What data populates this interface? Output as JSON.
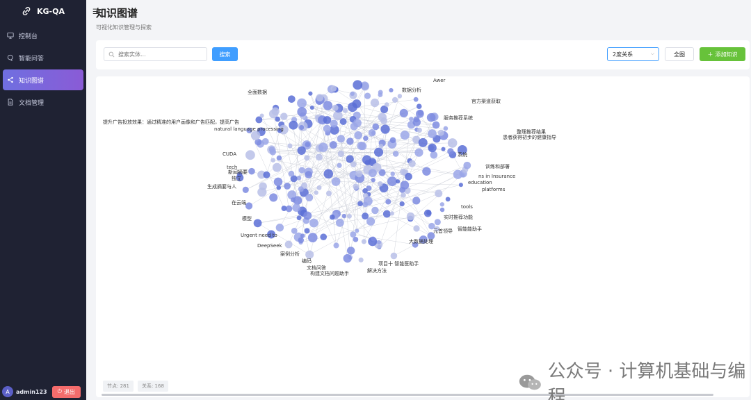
{
  "app": {
    "name": "KG-QA"
  },
  "sidebar": {
    "items": [
      {
        "label": "控制台",
        "icon": "monitor-icon"
      },
      {
        "label": "智能问答",
        "icon": "chat-icon"
      },
      {
        "label": "知识图谱",
        "icon": "share-icon"
      },
      {
        "label": "文档管理",
        "icon": "document-icon"
      }
    ]
  },
  "user": {
    "avatar": "A",
    "name": "admin123",
    "logout": "退出"
  },
  "page": {
    "title": "知识图谱",
    "subtitle": "可视化知识管理与探索"
  },
  "toolbar": {
    "search_placeholder": "搜索实体...",
    "search_button": "搜索",
    "relation_select": "2度关系",
    "full_button": "全图",
    "add_button": "添加知识"
  },
  "graph": {
    "labels": [
      "提升广告投放效果：通过精准的用户画像和广告匹配，提高广告",
      "官方渠道获取",
      "数据分析",
      "整理推荐结果",
      "患者获得初步的健康指导",
      "CUDA",
      "tech",
      "新闻摘要",
      "独立",
      "生成摘要与人",
      "在云端",
      "模型",
      "Urgent need to",
      "DeepSeek",
      "案例分析",
      "编码",
      "文档问答",
      "构建文档问题助手",
      "解决方法",
      "项目十 智能医助手",
      "服务推荐系统",
      "训练和部署",
      "ns in Insurance",
      "education",
      "platforms",
      "tools",
      "实时推荐功能",
      "元首领导",
      "大数据处理",
      "智能能助手",
      "natural language processing",
      "全面数据",
      "系统",
      "Awer"
    ],
    "nodes": 281,
    "relations": 168
  },
  "stats": {
    "nodes_label": "节点: 281",
    "relations_label": "关系: 168"
  },
  "watermark": "公众号 · 计算机基础与编程"
}
